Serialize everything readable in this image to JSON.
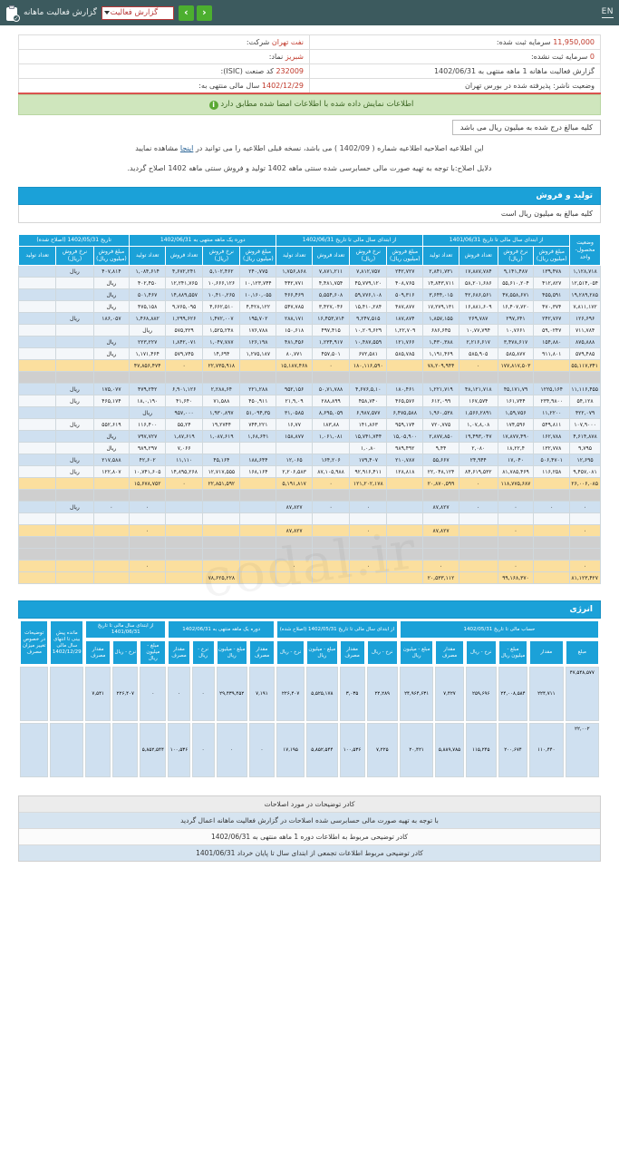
{
  "topbar": {
    "clipboard_icon": "clipboard-check-icon",
    "title": "گزارش فعالیت ماهانه",
    "report_select_value": "گزارش فعالیت",
    "prev_label": "‹",
    "next_label": "›",
    "lang_toggle": "EN"
  },
  "company": {
    "name_label": "شرکت:",
    "name_value": "نفت تهران",
    "capital_label": "سرمایه ثبت شده:",
    "capital_value": "11,950,000",
    "symbol_label": "نماد:",
    "symbol_value": "شبریز",
    "unregistered_capital_label": "سرمایه ثبت نشده:",
    "unregistered_capital_value": "0",
    "isic_label": "کد صنعت (ISIC):",
    "isic_value": "232009",
    "period_label": "گزارش فعالیت ماهانه 1 ماهه منتهی به 1402/06/31",
    "fiscal_year_label": "سال مالی منتهی به:",
    "fiscal_year_value": "1402/12/29",
    "status_label": "وضعیت ناشر: پذیرفته شده در بورس تهران"
  },
  "notice": {
    "icon": "info-icon",
    "text": "اطلاعات نمایش داده شده با اطلاعات امضا شده مطابق دارد"
  },
  "unit_box": "کلیه مبالغ درج شده به میلیون ریال می باشد",
  "amendment": {
    "line1_a": "این اطلاعیه اصلاحیه اطلاعیه شماره ( 1402/09 ) می باشد، نسخه قبلی اطلاعیه را می توانید در",
    "link_text": "اینجا",
    "line1_b": "مشاهده نمایید",
    "line2": "دلایل اصلاح:با توجه به تهیه صورت مالی حسابرسی شده سنتی ماهه 1402 تولید و فروش سنتی ماهه 1402 اصلاح گردید."
  },
  "production_section": {
    "title": "تولید و فروش",
    "subtitle": "کلیه مبالغ به میلیون ریال است"
  },
  "table": {
    "group_headers": [
      {
        "label": "تاریخ 1402/05/31 (اصلاح شده)",
        "span": 3
      },
      {
        "label": "دوره یک ماهه منتهی به 1402/06/31",
        "span": 4
      },
      {
        "label": "از ابتدای سال مالی تا تاریخ 1402/06/31",
        "span": 4
      },
      {
        "label": "از ابتدای سال مالی تا تاریخ 1401/06/31",
        "span": 4
      },
      {
        "label": "وضعیت محصول-واحد",
        "span": 1
      }
    ],
    "sub_headers": [
      "مبلغ فروش (میلیون ریال)",
      "نرخ فروش (ریال)",
      "تعداد تولید",
      "مبلغ فروش (میلیون ریال)",
      "نرخ فروش (ریال)",
      "تعداد فروش",
      "تعداد تولید",
      "مبلغ فروش (میلیون ریال)",
      "نرخ فروش (ریال)",
      "تعداد فروش",
      "تعداد تولید",
      "مبلغ فروش (میلیون ریال)",
      "نرخ فروش (ریال)",
      "تعداد فروش",
      "تعداد تولید",
      "وضعیت محصول-واحد"
    ],
    "rows": [
      {
        "style": "r-blue",
        "cells": [
          "۱,۱۲۸,۷۱۸",
          "۱۳۹,۴۷۸",
          "۹,۱۴۱,۴۸۷",
          "۱۷,۸۸۷,۷۸۴",
          "۲,۸۴۱,۷۳۱",
          "۲۴۲,۷۲۷",
          "۷,۸۱۲,۷۵۷",
          "۷,۸۷۱,۲۱۱",
          "۱,۷۵۶,۸۶۸",
          "۲۴۰,۷۷۵",
          "۵,۱۰۲,۴۶۲",
          "۴,۶۷۲,۲۴۱",
          "۱,۰۸۴,۶۱۴",
          "۴۰۷,۸۱۴",
          "ریال"
        ]
      },
      {
        "style": "r-white",
        "cells": [
          "۱۲,۵۱۴,۰۵۴",
          "۴۱۲,۸۲۷",
          "۵۵,۶۱۰,۲۰۴",
          "۵۸,۲۰۱,۶۸۶",
          "۱۴,۸۴۳,۷۱۱",
          "۴۰۸,۷۶۵",
          "۴۵,۷۷۹,۱۲۰",
          "۴,۴۸۱,۷۵۴",
          "۴۴۲,۷۷۱",
          "۱۰,۱۲۳,۷۴۴",
          "۱۰,۶۶۶,۱۲۶",
          "۱۲,۲۴۱,۷۶۵",
          "۴۰۲,۴۵۰",
          "ریال",
          ""
        ]
      },
      {
        "style": "r-blue",
        "cells": [
          "۱۹,۲۸۹,۲۸۵",
          "۴۵۵,۵۹۱",
          "۴۷,۵۵۸,۶۷۱",
          "۴۲,۶۸۶,۵۶۱",
          "۳,۶۴۴,۰۱۵",
          "۵۰۹,۳۱۶",
          "۵۹,۷۷۶,۱۰۸",
          "۵,۵۵۴,۶۰۸",
          "۴۶۶,۴۶۹",
          "۱۰,۱۶۰,۰۵۵",
          "۱۰,۴۱۰,۲۶۵",
          "۱۴,۸۸۹,۵۵۷",
          "۵۰۱,۴۶۷",
          "ریال",
          ""
        ]
      },
      {
        "style": "r-white",
        "cells": [
          "۷,۸۱۱,۱۷۲",
          "۴۷۰,۳۷۴",
          "۱۶,۴۰۷,۷۲۰",
          "۱۶,۸۸۱,۶۰۹",
          "۱۷,۲۷۹,۱۳۱",
          "۴۸۷,۸۷۷",
          "۱۵,۴۱۰,۲۸۴",
          "۳,۴۲۷,۰۴۶",
          "۵۴۷,۷۸۵",
          "۴,۴۲۸,۱۲۲",
          "۴,۶۶۲,۵۱۰",
          "۹,۷۶۵,۰۹۵",
          "۴۷۵,۱۵۸",
          "ریال",
          ""
        ]
      },
      {
        "style": "r-blue",
        "cells": [
          "۱۲۶,۶۹۶",
          "۲۴۲,۷۶۷",
          "۲۹۷,۶۴۱",
          "۲۶۹,۷۸۷",
          "۱,۸۵۷,۱۵۵",
          "۱۸۷,۸۷۴",
          "۹,۲۴۷,۵۱۵",
          "۱۶,۴۵۳,۷۱۴",
          "۲۸۸,۱۷۱",
          "۱۹۵,۷۰۲",
          "۱,۴۷۲,۰۰۷",
          "۱,۲۹۹,۶۲۶",
          "۱,۴۶۸,۸۸۲",
          "۱۸۶,۰۵۷",
          "ریال"
        ]
      },
      {
        "style": "r-white",
        "cells": [
          "۷۱۱,۷۸۴",
          "۵۹,۰۲۴۷",
          "۱۰,۷۶۶۱",
          "۱۰,۷۷,۷۹۴",
          "۶۸۶,۶۴۵",
          "۱,۲۲,۷۰۹",
          "۱۰,۲۰۹,۶۲۹",
          "۴۹۷,۴۱۵",
          "۱۵۰,۶۱۸",
          "۱۷۶,۷۸۸",
          "۱,۵۲۵,۲۴۸",
          "۵۷۵,۳۲۹",
          "ریال",
          "",
          ""
        ]
      },
      {
        "style": "r-blue",
        "cells": [
          "۸۷۵,۸۸۸",
          "۱۵۴,۸۸۰",
          "۳,۴۷۸,۶۱۷",
          "۲,۲۱۶,۶۱۷",
          "۱,۴۳۰,۳۸۸",
          "۱۲۱,۷۶۶",
          "۱۰,۴۸۷,۵۵۹",
          "۱,۲۳۴,۹۱۷",
          "۴۸۱,۴۵۶",
          "۱۲۶,۱۹۸",
          "۱,۰۴۷,۷۸۷",
          "۱,۸۴۲,۰۷۱",
          "۲۲۳,۲۲۷",
          "ریال",
          ""
        ]
      },
      {
        "style": "r-white",
        "cells": [
          "۵۷۹,۴۸۵",
          "۹۱۱,۸۰۱",
          "۵۸۵,۸۷۷",
          "۵۸۵,۹۰۵",
          "۱,۱۹۱,۴۶۹",
          "۵۸۵,۷۸۵",
          "۶۷۲,۵۸۱",
          "۴۵۷,۵۰۱",
          "۸۰,۷۷۱",
          "۱,۲۷۵,۱۸۷",
          "۱۴,۶۹۴",
          "۵۷۹,۷۴۵",
          "۱,۱۷۱,۴۶۴",
          "ریال",
          ""
        ]
      },
      {
        "style": "r-yellow",
        "cells": [
          "۵۵,۱۱۷,۳۴۱",
          "",
          "۱۷۷,۸۱۷,۵۰۳",
          "۰",
          "۷۸,۲۰۹,۹۴۴",
          "",
          "۱۸۰,۱۱۶,۵۹۰",
          "۰",
          "۱۵,۱۸۷,۴۶۸",
          "",
          "۲۲,۷۳۵,۹۱۸",
          "۰",
          "۴۷,۸۵۶,۴۷۴",
          ""
        ]
      },
      {
        "style": "r-empty",
        "cells": [
          "",
          "",
          "",
          "",
          "",
          "",
          "",
          "",
          "",
          "",
          "",
          "",
          "",
          ""
        ]
      },
      {
        "style": "r-blue",
        "cells": [
          "۱۱,۱۱۶,۴۵۵",
          "۱۲۲۵,۱۶۴",
          "۴۵,۱۷۱,۷۹",
          "۴۸,۱۲۱,۷۱۸",
          "۱,۲۲۱,۷۱۹",
          "۱۸۰,۴۶۱",
          "۴,۶۷۶,۵,۱۰",
          "۵۰,۷۱,۷۸۸",
          "۹۵۲,۱۵۶",
          "۲۲۱,۲۸۸",
          "۲,۲۸۸,۶۴",
          "۶,۹۰۱,۱۲۶",
          "۴۷۹,۲۴۲",
          "۱۷۵,۰۷۷",
          "ریال"
        ]
      },
      {
        "style": "r-white",
        "cells": [
          "۵۴,۱۲۸",
          "۲۳۴,۹۸۰۰",
          "۱۶۱,۷۴۴",
          "۱۶۷,۵۷۴",
          "۶۱۲,۰۹۹",
          "۴۶۵,۵۷۶",
          "۴۵۸,۷۴۰",
          "۲۸۸,۸۹۹",
          "۲۱,۹,۰۹",
          "۴۵۰,۹۱۱",
          "۷۱,۵۸۸",
          "۴۱,۶۴۰",
          "۱۸,۰,۱۹۰",
          "۴۶۵,۱۷۴",
          "ریال"
        ]
      },
      {
        "style": "r-blue",
        "cells": [
          "۴۲۲,۰۷۹",
          "۱۱,۲۲۰۰",
          "۱,۵۹,۷۵۶",
          "۱,۵۶۶,۲۸۹۱",
          "۱,۹۶۰,۵۳۸",
          "۶,۴۷۵,۵۸۸",
          "۶,۹۸۷,۵۷۷",
          "۸,۶۹۵,۰۵۹",
          "۳۱,۰۵۸۵",
          "۵۱,۰۹۴,۳۵",
          "۱,۹۳۰,۸۹۷",
          "۹۵۷,۰۰۰",
          "ریال",
          "",
          ""
        ]
      },
      {
        "style": "r-white",
        "cells": [
          "۱۰۷,۹۰۰۰",
          "۵۴۹,۸۱۱",
          "۱۷۴,۵۹۶",
          "۱,۰۷,۸,۰۸",
          "۷۲۰,۷۷۵",
          "۹۵۹,۱۷۴",
          "۱۴۱,۸۶۳",
          "۱۸۳,۸۸",
          "۱۶,۷۷",
          "۷۴۴,۲۲۱",
          "۱۹,۲۷۴۴",
          "۵۵,۲۴",
          "۱۱۶,۴۰۰",
          "۵۵۲,۶۱۹",
          "ریال"
        ]
      },
      {
        "style": "r-blue",
        "cells": [
          "۴,۶۱۴,۸۷۸",
          "۱۶۲,۷۸۸",
          "۱۷,۸۷۷,۴۹۰",
          "۱۹,۴۹۳,۰۴۷",
          "۲,۸۷۷,۸۵۰",
          "۱۵,۰۵,۹۰۰",
          "۱۵,۷۴۱,۷۴۴",
          "۱,۰۶۱,۰۸۱",
          "۱۵۸,۸۷۷",
          "۱,۶۸,۶۴۱",
          "۱,۰۸۷,۶۱۹",
          "۱,۸۷,۶۱۹",
          "۷۹۷,۷۲۷",
          "ریال",
          ""
        ]
      },
      {
        "style": "r-white",
        "cells": [
          "۹,۷۹۵",
          "۱۳۲,۷۷۸",
          "۱۸,۲۲,۴",
          "۲,۰۸۰",
          "۹,۴۴",
          "۹۸۹,۴۹۲",
          "۱,۰,۸۰",
          "",
          "",
          "",
          "",
          "۷,۰۶۶",
          "۹۸۹,۲۹۷",
          "ریال",
          ""
        ]
      },
      {
        "style": "r-blue",
        "cells": [
          "۱۲,۶۹۵",
          "۵۰۶,۴۷۰۱",
          "۱۷,۰۴۰",
          "۲۴,۹۴۴",
          "۵۵,۶۶۷",
          "۲۱۰,۷۸۷",
          "۱۷۹,۴۰۷",
          "۱۶۴,۲۰۶",
          "۱۲,۰۶۵",
          "۱۸۸,۶۴۴",
          "۴۵,۱۶۴",
          "۱۱,۱۱۰",
          "۴۲,۶۰۲",
          "۲۱۷,۵۸۸",
          "ریال"
        ]
      },
      {
        "style": "r-white",
        "cells": [
          "۹,۴۵۷,۰۸۱",
          "۱۱۶,۲۵۸",
          "۸۱,۷۸۵,۴۶۹",
          "۸۴,۶۱۹,۵۳۲",
          "۲۲,۰۴۸,۱۲۴",
          "۱۲۸,۸۱۸",
          "۹۲,۹۱۶,۴۱۱",
          "۸۷,۱۰۵,۹۸۸",
          "۲,۲۰۶,۵۸۳",
          "۱۶۸,۱۶۴",
          "۱۲,۷۱۷,۵۵۵",
          "۱۴,۸۹۵,۲۶۸",
          "۱۰,۷۴۱,۶۰۵",
          "۱۲۲,۸۰۷",
          "ریال"
        ]
      },
      {
        "style": "r-yellow",
        "cells": [
          "۲۶,۰۰۶,۰۸۵",
          "",
          "۱۱۸,۷۷۵,۶۸۷",
          "۰",
          "۲۰,۸۷۰,۵۹۹",
          "",
          "۱۲۱,۲۰۲,۱۷۸",
          "۰",
          "۵,۱۹۱,۸۱۷",
          "",
          "۲۲,۸۵۱,۵۹۲",
          "۰",
          "۱۵,۶۷۸,۷۵۲",
          ""
        ]
      },
      {
        "style": "r-empty",
        "cells": [
          "",
          "",
          "",
          "",
          "",
          "",
          "",
          "",
          "",
          "",
          "",
          "",
          "",
          ""
        ]
      },
      {
        "style": "r-blue",
        "cells": [
          "۰",
          "۰",
          "۰",
          "۰",
          "۸۷,۸۲۷",
          "",
          "۰",
          "۰",
          "۸۷,۸۲۷",
          "",
          "",
          "",
          "۰",
          "۰",
          "ریال"
        ]
      },
      {
        "style": "r-white",
        "cells": [
          "",
          "",
          "",
          "",
          "",
          "",
          "",
          "",
          "",
          "",
          "",
          "",
          "",
          ""
        ]
      },
      {
        "style": "r-yellow",
        "cells": [
          "۰",
          "",
          "۰",
          "",
          "۸۷,۸۲۷",
          "",
          "۰",
          "",
          "۸۷,۸۲۷",
          "",
          "",
          "",
          "۰",
          ""
        ]
      },
      {
        "style": "r-empty",
        "cells": [
          "",
          "",
          "",
          "",
          "",
          "",
          "",
          "",
          "",
          "",
          "",
          "",
          "",
          ""
        ]
      },
      {
        "style": "r-grey",
        "cells": [
          "",
          "",
          "",
          "",
          "",
          "",
          "",
          "",
          "",
          "",
          "",
          "",
          "",
          ""
        ]
      },
      {
        "style": "r-yellow",
        "cells": [
          "۰",
          "",
          "۰",
          "",
          "۰",
          "",
          "۰",
          "",
          "۰",
          "",
          "",
          "",
          "۰",
          ""
        ]
      },
      {
        "style": "r-yellow",
        "cells": [
          "۸۱,۱۲۳,۴۲۷",
          "",
          "۹۹,۱۶۸,۳۷۰",
          "",
          "۲۰,۵۳۳,۱۱۲",
          "",
          "",
          "",
          "",
          "",
          "۷۸,۶۲۵,۲۲۸",
          "",
          "",
          ""
        ]
      }
    ]
  },
  "energy_section": {
    "title": "انرژی",
    "group_headers": [
      {
        "label": "حساب مالی تا تاریخ 1402/05/31",
        "span": 4
      },
      {
        "label": "از ابتدای سال مالی تا تاریخ 1402/05/31 (اصلاح شده)",
        "span": 4
      },
      {
        "label": "دوره یک ماهه منتهی به 1402/06/31",
        "span": 4
      },
      {
        "label": "از ابتدای سال مالی تا تاریخ 1401/06/31",
        "span": 4
      },
      {
        "label": "مانده پیش بینی تا انتهای سال مالی 1402/12/29",
        "span": 1
      },
      {
        "label": "توضیحات در خصوص تغییر میزان مصرف",
        "span": 1
      }
    ],
    "sub_headers": [
      "مبلغ - میلیون ریال",
      "نرخ - ریال",
      "مقدار مصرف",
      "مبلغ - میلیون ریال",
      "نرخ - ریال",
      "مقدار مصرف",
      "مبلغ - میلیون ریال",
      "نرخ - ریال",
      "مقدار مصرف",
      "مبلغ - میلیون ریال",
      "نرخ - ریال",
      "مقدار مصرف",
      "مبلغ",
      "مقدار",
      "مبلغ - میلیون ریال",
      "نرخ - ریال",
      "مقدار مصرف",
      "مقدار مصرف",
      "توضیحات در خصوص تغییر میزان مصرف"
    ],
    "rows": [
      {
        "cells": [
          "۴۷,۵۴۸,۵۷۷",
          "۲۲۴,۷۱۱",
          "۲۴,۰۰۸,۵۸۴",
          "۲۵۹,۶۹۶",
          "۷,۴۲۷",
          "۲۴,۹۶۴,۶۳۱",
          "۲۲,۲۸۹",
          "۳,۰۳۵",
          "۵,۵۲۵,۱۷۸",
          "۲۲۶,۴۰۷",
          "۷,۱۹۱",
          "۲۹,۴۳۹,۴۵۲",
          "۰",
          "۰",
          "۰",
          "۲۲۶,۴۰۷",
          "۷,۵۴۱",
          "",
          ""
        ]
      },
      {
        "cells": [
          "۲۲,۰۰۲",
          "۱۱۰,۴۴۰",
          "۲۰۰,۶۷۴",
          "۱۱۵,۲۴۵",
          "۵,۸۸۹,۷۸۵",
          "۲۰,۴۲۱",
          "۷,۲۲۵",
          "۱۰۰,۵۳۶",
          "۵,۸۵۲,۵۴۴",
          "۱۷,۱۹۵",
          "۰",
          "۰",
          "۰",
          "۱۰۰,۵۳۶",
          "۵,۸۵۲,۵۴۴",
          "",
          "",
          "",
          ""
        ]
      }
    ]
  },
  "footer_notes": [
    {
      "style": "grey",
      "text": "کادر توضیحات در مورد اصلاحات"
    },
    {
      "style": "blue",
      "text": "با توجه به تهیه صورت مالی حسابرسی شده اصلاحات در گزارش فعالیت ماهانه اعمال گردید"
    },
    {
      "style": "white",
      "text": "کادر توضیحی مربوط به اطلاعات دوره 1 ماهه منتهی به 1402/06/31"
    },
    {
      "style": "blue",
      "text": "کادر توضیحی مربوط اطلاعات تجمعی از ابتدای سال تا پایان خرداد 1401/06/31"
    }
  ],
  "watermark": "codal.ir",
  "colors": {
    "header_bg": "#3c5a5e",
    "accent_blue": "#1ba1d8",
    "green_notice": "#cfe6bd",
    "row_blue": "#cfe0f0",
    "row_yellow": "#fbdf9e",
    "nav_green": "#4caf2f",
    "red_value": "#c0392b"
  }
}
